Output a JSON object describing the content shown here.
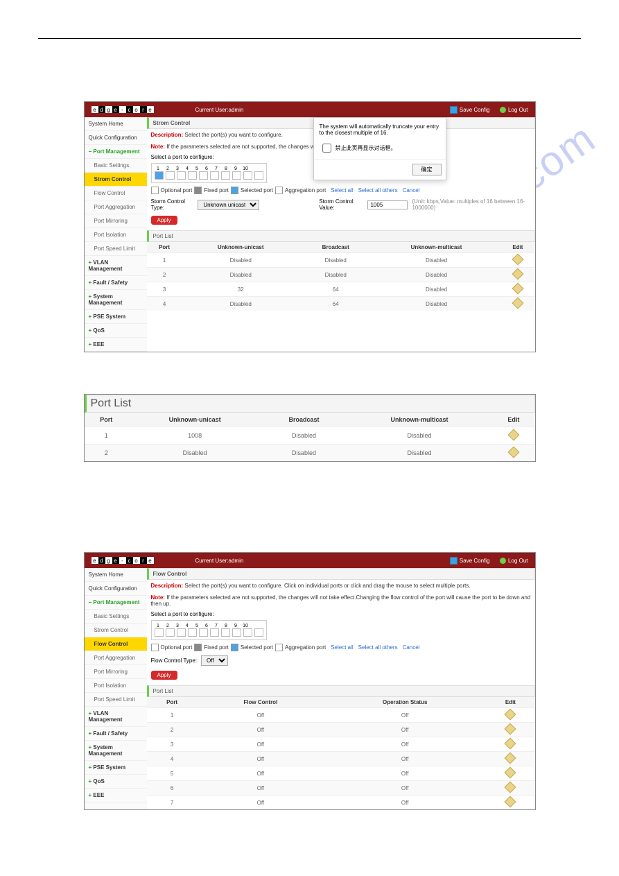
{
  "fig1": {
    "logo": [
      "e",
      "d",
      "g",
      "e",
      "-",
      "c",
      "o",
      "r",
      "e"
    ],
    "current_user": "Current User:admin",
    "save_config": "Save Config",
    "logout": "Log Out",
    "sidebar": {
      "items": [
        {
          "label": "System Home",
          "type": "plain"
        },
        {
          "label": "Quick Configuration",
          "type": "plain"
        },
        {
          "label": "Port Management",
          "type": "expand"
        },
        {
          "label": "Basic Settings",
          "type": "sub"
        },
        {
          "label": "Strom Control",
          "type": "active"
        },
        {
          "label": "Flow Control",
          "type": "sub"
        },
        {
          "label": "Port Aggregation",
          "type": "sub"
        },
        {
          "label": "Port Mirroring",
          "type": "sub"
        },
        {
          "label": "Port Isolation",
          "type": "sub"
        },
        {
          "label": "Port Speed Limit",
          "type": "sub"
        },
        {
          "label": "VLAN Management",
          "type": "collapse"
        },
        {
          "label": "Fault / Safety",
          "type": "collapse"
        },
        {
          "label": "System Management",
          "type": "collapse"
        },
        {
          "label": "PSE System",
          "type": "collapse"
        },
        {
          "label": "QoS",
          "type": "collapse"
        },
        {
          "label": "EEE",
          "type": "collapse"
        }
      ]
    },
    "page_title": "Strom Control",
    "desc_label": "Description:",
    "desc_text": "Select the port(s) you want to configure.",
    "note_label": "Note:",
    "note_text": "If the parameters selected are not supported, the changes will not take effect.",
    "select_port_label": "Select a port to configure:",
    "port_nums": [
      "1",
      "2",
      "3",
      "4",
      "5",
      "6",
      "7",
      "8",
      "9",
      "10"
    ],
    "legend": {
      "optional": "Optional port",
      "fixed": "Fixed port",
      "selected": "Selected port",
      "agg": "Aggregation port",
      "select_all": "Select all",
      "select_others": "Select all others",
      "cancel": "Cancel"
    },
    "storm_type_label": "Storm Control Type:",
    "storm_type_value": "Unknown unicast",
    "storm_value_label": "Storm Control Value:",
    "storm_value_value": "1005",
    "storm_value_hint": "(Unit: kbps,Value: multiples of 16 between 16-1000000)",
    "apply": "Apply",
    "port_list_label": "Port List",
    "table": {
      "headers": [
        "Port",
        "Unknown-unicast",
        "Broadcast",
        "Unknown-multicast",
        "Edit"
      ],
      "rows": [
        [
          "1",
          "Disabled",
          "Disabled",
          "Disabled"
        ],
        [
          "2",
          "Disabled",
          "Disabled",
          "Disabled"
        ],
        [
          "3",
          "32",
          "64",
          "Disabled"
        ],
        [
          "4",
          "Disabled",
          "64",
          "Disabled"
        ]
      ]
    },
    "dialog": {
      "message": "The system will automatically truncate your entry to the closest multiple of 16.",
      "checkbox": "禁止此页再显示对话框。",
      "ok": "确定"
    }
  },
  "fig2": {
    "port_list_label": "Port List",
    "headers": [
      "Port",
      "Unknown-unicast",
      "Broadcast",
      "Unknown-multicast",
      "Edit"
    ],
    "rows": [
      [
        "1",
        "1008",
        "Disabled",
        "Disabled"
      ],
      [
        "2",
        "Disabled",
        "Disabled",
        "Disabled"
      ]
    ]
  },
  "fig3": {
    "logo": [
      "e",
      "d",
      "g",
      "e",
      "-",
      "c",
      "o",
      "r",
      "e"
    ],
    "current_user": "Current User:admin",
    "save_config": "Save Config",
    "logout": "Log Out",
    "sidebar": {
      "items": [
        {
          "label": "System Home",
          "type": "plain"
        },
        {
          "label": "Quick Configuration",
          "type": "plain"
        },
        {
          "label": "Port Management",
          "type": "expand"
        },
        {
          "label": "Basic Settings",
          "type": "sub"
        },
        {
          "label": "Strom Control",
          "type": "sub"
        },
        {
          "label": "Flow Control",
          "type": "active"
        },
        {
          "label": "Port Aggregation",
          "type": "sub"
        },
        {
          "label": "Port Mirroring",
          "type": "sub"
        },
        {
          "label": "Port Isolation",
          "type": "sub"
        },
        {
          "label": "Port Speed Limit",
          "type": "sub"
        },
        {
          "label": "VLAN Management",
          "type": "collapse"
        },
        {
          "label": "Fault / Safety",
          "type": "collapse"
        },
        {
          "label": "System Management",
          "type": "collapse"
        },
        {
          "label": "PSE System",
          "type": "collapse"
        },
        {
          "label": "QoS",
          "type": "collapse"
        },
        {
          "label": "EEE",
          "type": "collapse"
        }
      ]
    },
    "page_title": "Flow Control",
    "desc_label": "Description:",
    "desc_text": "Select the port(s) you want to configure. Click on individual ports or click and drag the mouse to select multiple ports.",
    "note_label": "Note:",
    "note_text": "If the parameters selected are not supported, the changes will not take effect.Changing the flow control of the port will cause the port to be down and then up.",
    "select_port_label": "Select a port to configure:",
    "port_nums": [
      "1",
      "2",
      "3",
      "4",
      "5",
      "6",
      "7",
      "8",
      "9",
      "10"
    ],
    "legend": {
      "optional": "Optional port",
      "fixed": "Fixed port",
      "selected": "Selected port",
      "agg": "Aggregation port",
      "select_all": "Select all",
      "select_others": "Select all others",
      "cancel": "Cancel"
    },
    "flow_type_label": "Flow Control Type:",
    "flow_type_value": "Off",
    "apply": "Apply",
    "port_list_label": "Port List",
    "table": {
      "headers": [
        "Port",
        "Flow Control",
        "Operation Status",
        "Edit"
      ],
      "rows": [
        [
          "1",
          "Off",
          "Off"
        ],
        [
          "2",
          "Off",
          "Off"
        ],
        [
          "3",
          "Off",
          "Off"
        ],
        [
          "4",
          "Off",
          "Off"
        ],
        [
          "5",
          "Off",
          "Off"
        ],
        [
          "6",
          "Off",
          "Off"
        ],
        [
          "7",
          "Off",
          "Off"
        ]
      ]
    }
  },
  "watermark": "manualshive.com"
}
